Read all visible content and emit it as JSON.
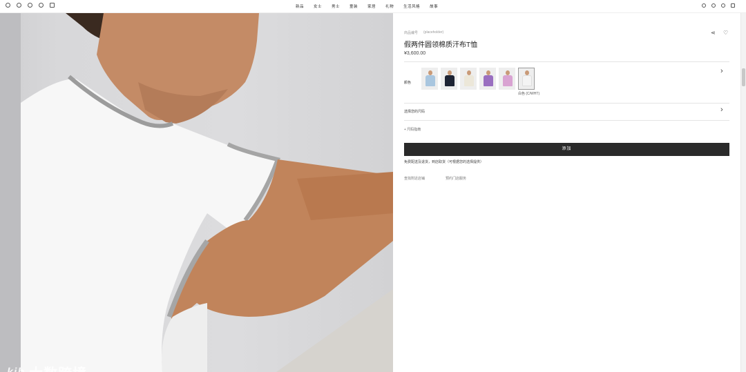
{
  "nav": {
    "left_icons": [
      "settings-icon",
      "location-icon",
      "pin-icon",
      "phone-icon",
      "mail-icon"
    ],
    "menu": [
      "新品",
      "女士",
      "男士",
      "童装",
      "家居",
      "礼物",
      "生活风格",
      "故事"
    ],
    "right_icons": [
      "search-icon",
      "heart-icon",
      "account-icon",
      "bag-icon"
    ]
  },
  "product": {
    "breadcrumb": [
      "商品编号",
      "(placeholder)"
    ],
    "title": "假两件圆领棉质汗布T恤",
    "price": "¥3,600.00",
    "color_label": "颜色",
    "swatches": [
      {
        "name": "浅蓝",
        "color": "#a9c6df"
      },
      {
        "name": "海军蓝",
        "color": "#1e2434"
      },
      {
        "name": "米白",
        "color": "#ece7d9"
      },
      {
        "name": "紫色",
        "color": "#9a6fc0"
      },
      {
        "name": "粉色",
        "color": "#d9a3d2"
      },
      {
        "name": "白色",
        "color": "#f4f4f4"
      }
    ],
    "selected_color": "白色 (C/WHT)",
    "size_label": "选择您的尺码",
    "size_guide": "+ 尺码指南",
    "add_button": "添加",
    "shipping_note": "免费配送及退货，到店取货（可根据您的选择提供）",
    "links": [
      "查找附近店铺",
      "预约门店服务"
    ]
  },
  "watermark": {
    "logo": "kjb",
    "text": "大数跨境"
  }
}
